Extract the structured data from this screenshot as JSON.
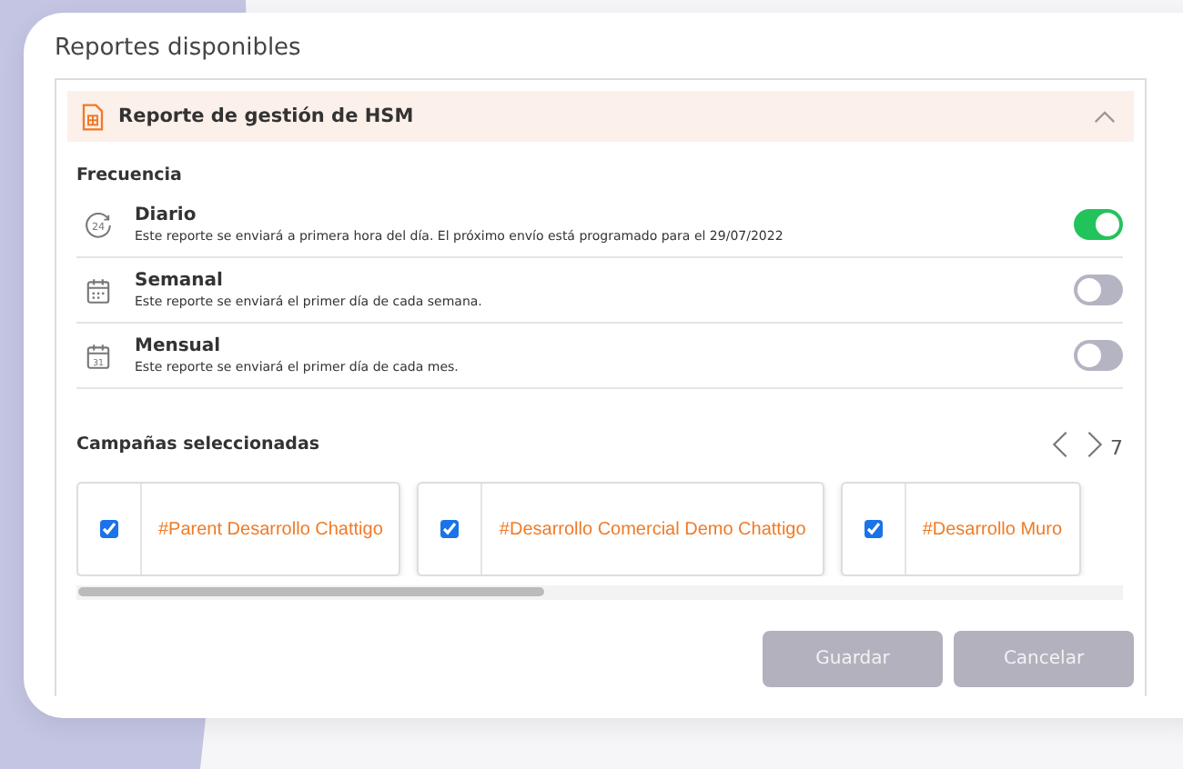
{
  "title": "Reportes disponibles",
  "report": {
    "name": "Reporte de gestión de HSM",
    "expanded": true
  },
  "frequency": {
    "heading": "Frecuencia",
    "options": [
      {
        "name": "Diario",
        "icon_label": "24",
        "description": "Este reporte se enviará a primera hora del día. El próximo envío está programado para el 29/07/2022",
        "on": true
      },
      {
        "name": "Semanal",
        "description": "Este reporte se enviará el primer día de cada semana.",
        "on": false
      },
      {
        "name": "Mensual",
        "icon_label": "31",
        "description": "Este reporte se enviará el primer día de cada mes.",
        "on": false
      }
    ]
  },
  "campaigns": {
    "heading": "Campañas seleccionadas",
    "count": "7",
    "items": [
      {
        "name": "#Parent Desarrollo Chattigo",
        "checked": true
      },
      {
        "name": "#Desarrollo Comercial Demo Chattigo",
        "checked": true
      },
      {
        "name": "#Desarrollo Muro",
        "checked": true
      }
    ]
  },
  "buttons": [
    {
      "label": "Guardar",
      "disabled": true
    },
    {
      "label": "Cancelar",
      "disabled": true
    }
  ]
}
